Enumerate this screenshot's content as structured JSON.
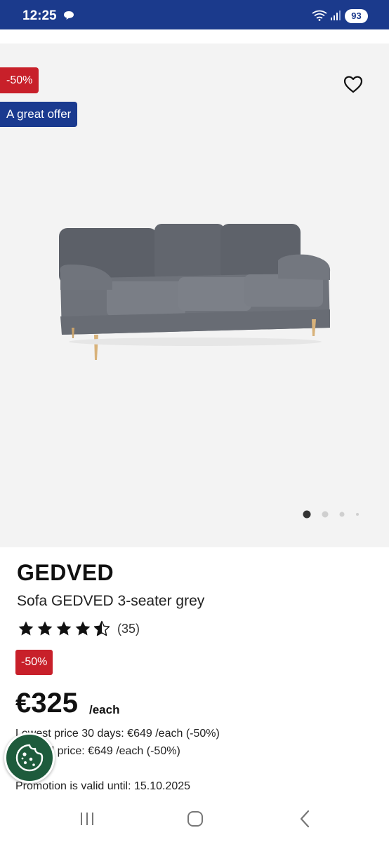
{
  "status_bar": {
    "time": "12:25",
    "battery": "93",
    "icons": [
      "message-icon",
      "wifi-icon",
      "signal-icon",
      "battery-icon"
    ]
  },
  "gallery": {
    "discount_badge": "-50%",
    "offer_badge": "A great offer",
    "favorite_icon": "heart-outline-icon",
    "image": "grey-3-seater-sofa",
    "carousel_total": 4,
    "carousel_active": 1
  },
  "product": {
    "brand": "GEDVED",
    "name": "Sofa GEDVED 3-seater grey",
    "rating_value": 4.5,
    "rating_count": "(35)",
    "discount_badge": "-50%",
    "price": "€325",
    "price_unit": "/each",
    "lowest_price": "Lowest price 30 days: €649 /each (-50%)",
    "original_price": "Original price: €649 /each (-50%)",
    "promotion": "Promotion is valid until: 15.10.2025"
  },
  "cookie_button": {
    "icon": "cookie-icon"
  },
  "nav_bar": {
    "icons": [
      "recents-icon",
      "home-icon",
      "back-icon"
    ]
  },
  "colors": {
    "status_bar": "#1b3a8c",
    "discount_red": "#c8202a",
    "offer_blue": "#1a3a8f",
    "cookie_green": "#1e5b3c"
  }
}
